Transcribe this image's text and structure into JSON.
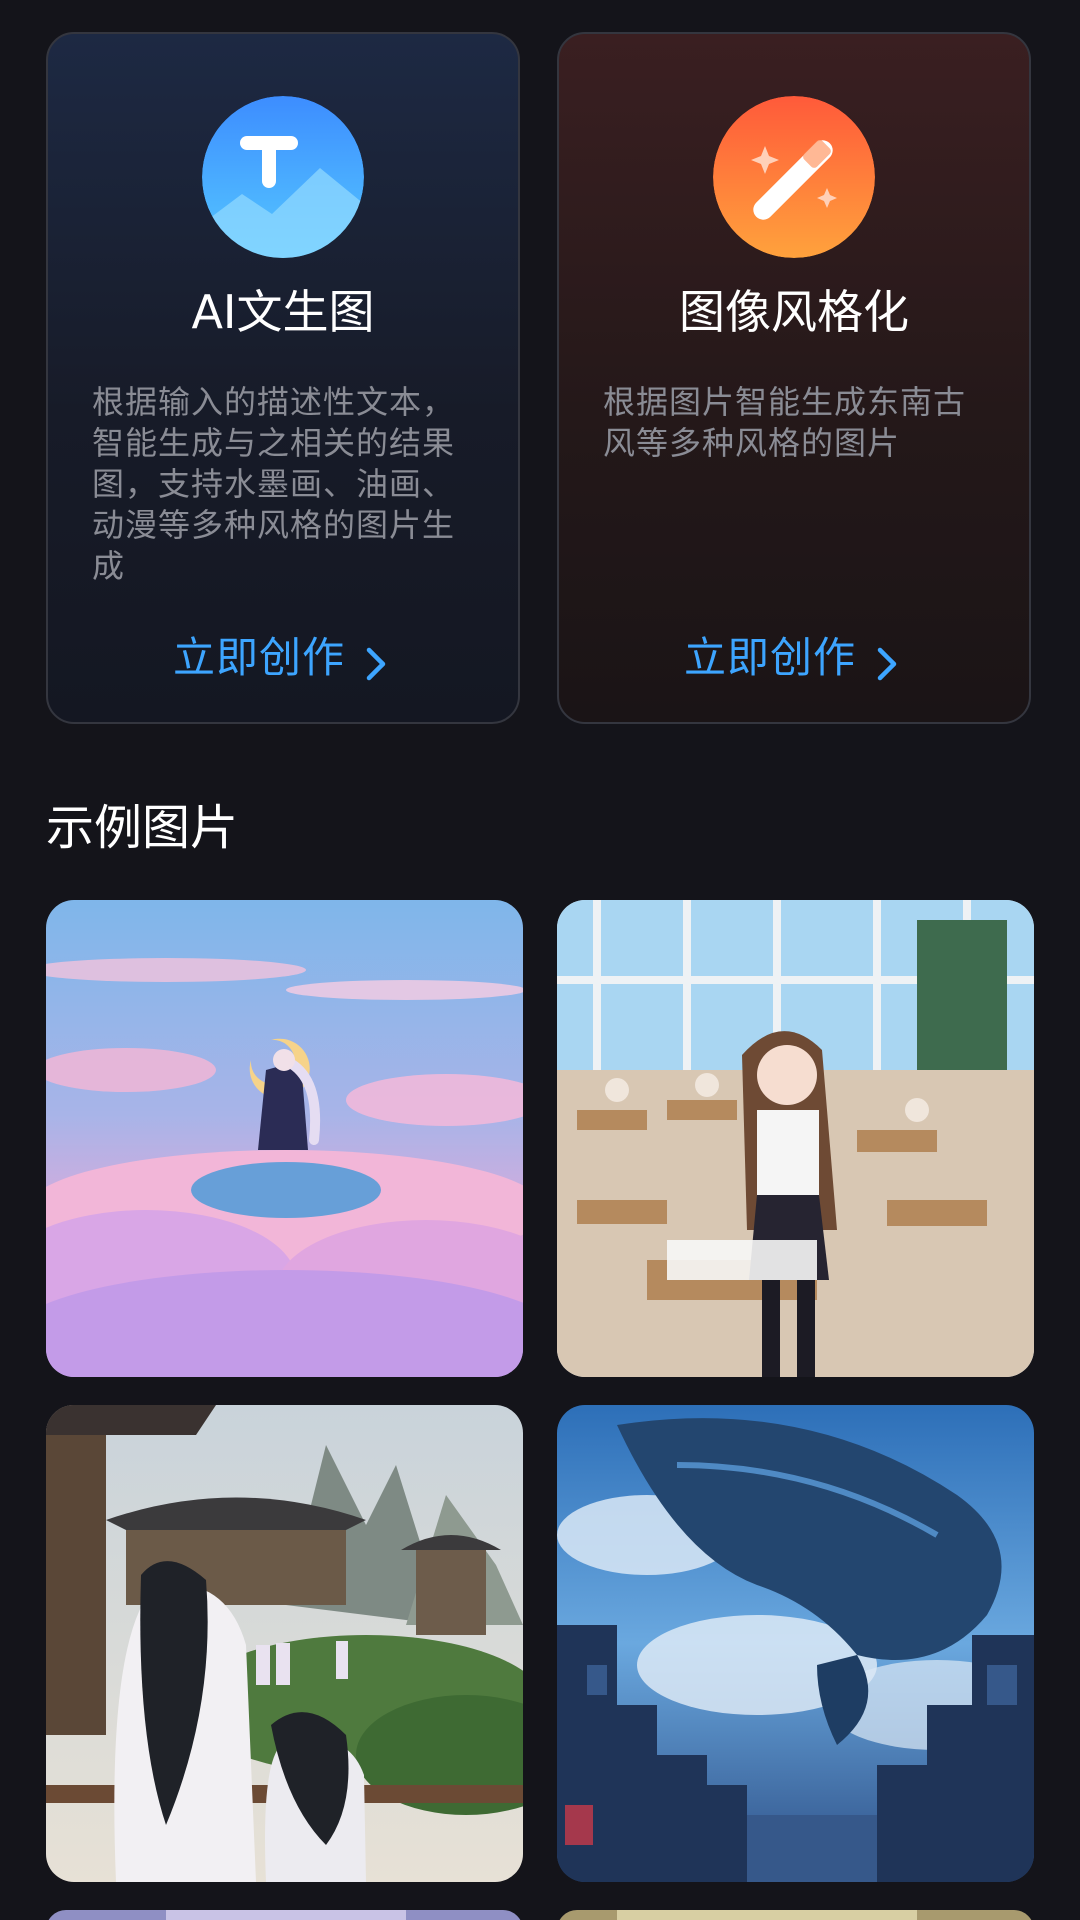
{
  "cards": [
    {
      "title": "AI文生图",
      "description": "根据输入的描述性文本，智能生成与之相关的结果图，支持水墨画、油画、动漫等多种风格的图片生成",
      "cta": "立即创作",
      "icon": "text-to-image-icon",
      "icon_color": "#4aa3ff"
    },
    {
      "title": "图像风格化",
      "description": "根据图片智能生成东南古风等多种风格的图片",
      "cta": "立即创作",
      "icon": "magic-wand-icon",
      "icon_color": "#ff7a3a"
    }
  ],
  "accent_color": "#3da5ff",
  "examples": {
    "title": "示例图片",
    "images": [
      {
        "name": "example-image-dreamy-sky"
      },
      {
        "name": "example-image-classroom"
      },
      {
        "name": "example-image-ancient-palace"
      },
      {
        "name": "example-image-sky-whale-city"
      }
    ]
  }
}
